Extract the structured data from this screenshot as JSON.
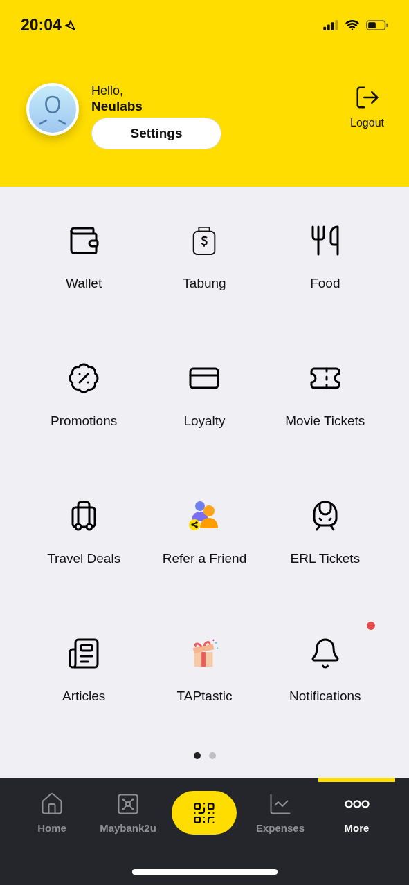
{
  "status_bar": {
    "time": "20:04"
  },
  "header": {
    "greeting": "Hello,",
    "name": "Neulabs",
    "settings_button": "Settings",
    "logout_label": "Logout"
  },
  "menu": [
    {
      "label": "Wallet",
      "badge": false
    },
    {
      "label": "Tabung",
      "badge": false
    },
    {
      "label": "Food",
      "badge": false
    },
    {
      "label": "Promotions",
      "badge": false
    },
    {
      "label": "Loyalty",
      "badge": false
    },
    {
      "label": "Movie Tickets",
      "badge": false
    },
    {
      "label": "Travel Deals",
      "badge": false
    },
    {
      "label": "Refer a Friend",
      "badge": false
    },
    {
      "label": "ERL Tickets",
      "badge": false
    },
    {
      "label": "Articles",
      "badge": false
    },
    {
      "label": "TAPtastic",
      "badge": false
    },
    {
      "label": "Notifications",
      "badge": true
    }
  ],
  "pages": [
    {
      "selected": true
    },
    {
      "selected": false
    }
  ],
  "bottom_nav": [
    {
      "kind": "tab",
      "label": "Home",
      "selected": false
    },
    {
      "kind": "tab",
      "label": "Maybank2u",
      "selected": false
    },
    {
      "kind": "scan",
      "selected": false
    },
    {
      "kind": "tab",
      "label": "Expenses",
      "selected": false
    },
    {
      "kind": "tab",
      "label": "More",
      "selected": true
    }
  ]
}
